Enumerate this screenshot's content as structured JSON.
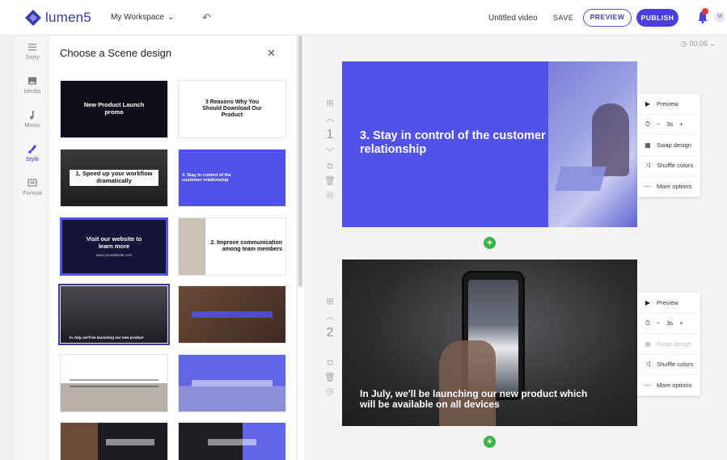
{
  "brand": {
    "name": "lumen5",
    "accent": "#4b3fe0",
    "logo_color": "#3a3aa8"
  },
  "header": {
    "workspace": "My Workspace",
    "video_title": "Untitled video",
    "save_label": "SAVE",
    "preview_label": "PREVIEW",
    "publish_label": "PUBLISH",
    "avatar_initial": "M"
  },
  "rail": [
    {
      "label": "Story",
      "icon": "lines-icon"
    },
    {
      "label": "Media",
      "icon": "image-icon"
    },
    {
      "label": "Music",
      "icon": "note-icon"
    },
    {
      "label": "Style",
      "icon": "brush-icon",
      "active": true
    },
    {
      "label": "Format",
      "icon": "format-icon"
    }
  ],
  "panel": {
    "title": "Choose a Scene design",
    "thumbnails": [
      {
        "text": "New Product Launch promo",
        "bg": "#0e0e1a",
        "fg": "#ffffff"
      },
      {
        "text": "3 Reasons Why You Should Download Our Product",
        "bg": "#ffffff",
        "fg": "#111111"
      },
      {
        "text": "1. Speed up your workflow dramatically",
        "bg": "#2b2b2b",
        "fg": "#111111"
      },
      {
        "text": "3. Stay in control of the customer relationship",
        "bg": "#5153e8",
        "fg": "#ffffff"
      },
      {
        "text": "Visit our website to learn more",
        "sub": "www.yourwebsite.com",
        "bg": "#14143a",
        "fg": "#ffffff"
      },
      {
        "text": "2. Improve communication among team members",
        "bg": "#ffffff",
        "fg": "#111111"
      },
      {
        "text": "In July, we'll be launching our new product",
        "bg": "#2a2a2e",
        "fg": "#ffffff",
        "selected": true
      },
      {
        "text": "",
        "bg": "#5a3d2e",
        "fg": "#ffffff"
      },
      {
        "text": "",
        "bg": "#ffffff",
        "fg": "#111111"
      },
      {
        "text": "",
        "bg": "#6266e6",
        "fg": "#ffffff"
      },
      {
        "text": "",
        "bg": "#3b2a22",
        "fg": "#ffffff"
      },
      {
        "text": "",
        "bg": "#ffffff",
        "fg": "#111111"
      }
    ]
  },
  "duration": "00:06",
  "scenes": [
    {
      "number": "1",
      "text": "3. Stay in control of the customer relationship",
      "menu": {
        "preview": "Preview",
        "duration": "3s",
        "swap": "Swap design",
        "shuffle": "Shuffle colors",
        "more": "More options"
      }
    },
    {
      "number": "2",
      "text": "In July, we'll be launching our new product which will be available on all devices",
      "menu": {
        "preview": "Preview",
        "duration": "3s",
        "swap": "Swap design",
        "shuffle": "Shuffle colors",
        "more": "More options"
      }
    }
  ]
}
